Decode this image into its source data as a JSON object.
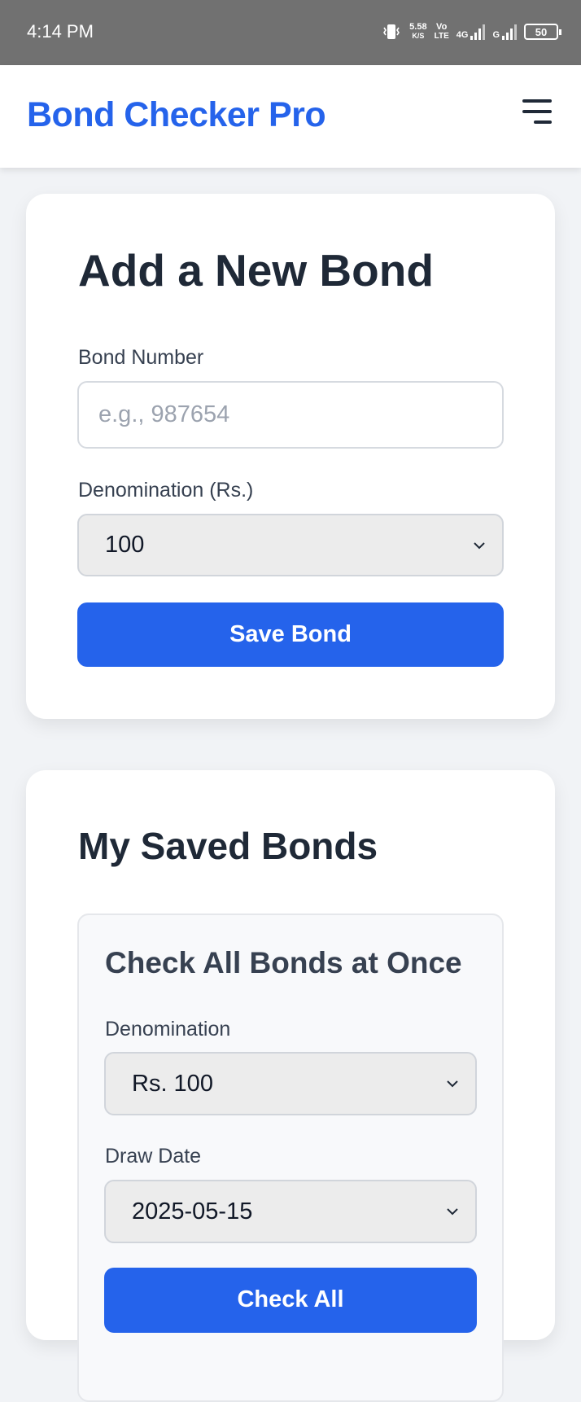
{
  "status_bar": {
    "time": "4:14 PM",
    "speed_value": "5.58",
    "speed_unit": "K/S",
    "volte_top": "Vo",
    "volte_bottom": "LTE",
    "net_4g": "4G",
    "net_g": "G",
    "battery": "50"
  },
  "header": {
    "title": "Bond Checker Pro",
    "menu_icon": "hamburger-menu-icon"
  },
  "add_bond": {
    "title": "Add a New Bond",
    "bond_number_label": "Bond Number",
    "bond_number_placeholder": "e.g., 987654",
    "denomination_label": "Denomination (Rs.)",
    "denomination_value": "100",
    "save_button": "Save Bond"
  },
  "saved_bonds": {
    "title": "My Saved Bonds",
    "check_all": {
      "title": "Check All Bonds at Once",
      "denomination_label": "Denomination",
      "denomination_value": "Rs. 100",
      "draw_date_label": "Draw Date",
      "draw_date_value": "2025-05-15",
      "check_button": "Check All"
    }
  },
  "colors": {
    "accent": "#2563eb",
    "heading": "#1f2937",
    "background": "#f1f3f6",
    "status_bar": "#717171"
  }
}
